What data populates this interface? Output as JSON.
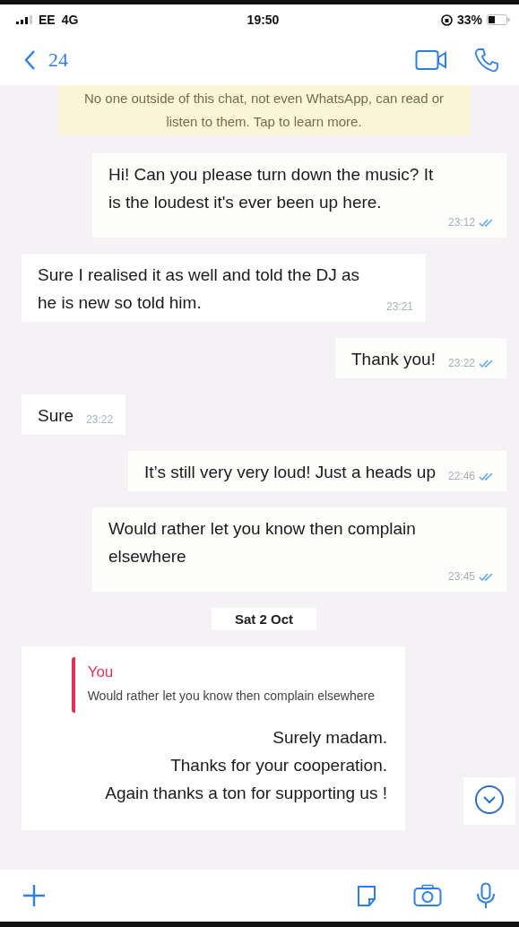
{
  "status_bar": {
    "carrier": "EE",
    "network": "4G",
    "time": "19:50",
    "battery": "33%"
  },
  "header": {
    "back_label": "24"
  },
  "encryption_notice": "No one outside of this chat, not even WhatsApp, can read or listen to them. Tap to learn more.",
  "messages": [
    {
      "kind": "sent",
      "text": "Hi! Can you please turn down the music? It is the loudest it's ever been up here.",
      "time": "23:12",
      "read": true
    },
    {
      "kind": "received",
      "text": "Sure I realised it as well and told the DJ as he is new so told him.",
      "time": "23:21"
    },
    {
      "kind": "sent",
      "text": "Thank you!",
      "time": "23:22",
      "read": true
    },
    {
      "kind": "received",
      "text": "Sure",
      "time": "23:22"
    },
    {
      "kind": "sent",
      "text": "It’s still very very loud! Just a heads up",
      "time": "22:46",
      "read": true
    },
    {
      "kind": "sent",
      "text": "Would rather let you know then complain elsewhere",
      "time": "23:45",
      "read": true
    },
    {
      "kind": "date",
      "text": "Sat 2 Oct"
    },
    {
      "kind": "reply",
      "quote": {
        "author": "You",
        "text": "Would rather let you know then complain elsewhere"
      },
      "lines": [
        "Surely madam.",
        "Thanks for your cooperation.",
        "Again thanks a ton for supporting us !"
      ]
    }
  ]
}
